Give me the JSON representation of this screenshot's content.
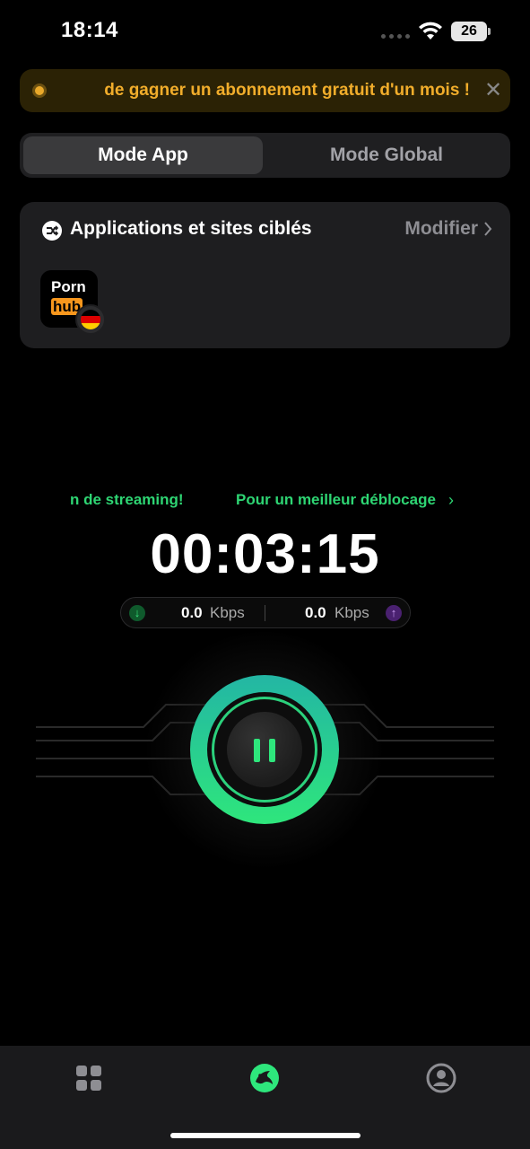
{
  "status_bar": {
    "time": "18:14",
    "battery": "26"
  },
  "promo": {
    "text": "de gagner un abonnement gratuit d'un mois !",
    "close_symbol": "✕",
    "accent_color": "#f1ad2b"
  },
  "mode_toggle": {
    "app_label": "Mode App",
    "global_label": "Mode Global",
    "selected": "Mode App"
  },
  "targets": {
    "title": "Applications et sites ciblés",
    "modify_label": "Modifier",
    "apps": [
      {
        "logo_top": "Porn",
        "logo_bottom": "hub",
        "country_flag": "germany-flag-icon"
      }
    ]
  },
  "ticker": {
    "text_1": "n de streaming!",
    "text_2": "Pour un meilleur déblocage",
    "color": "#2ed573"
  },
  "connection": {
    "elapsed": "00:03:15",
    "download_value": "0.0",
    "download_unit": "Kbps",
    "upload_value": "0.0",
    "upload_unit": "Kbps",
    "state_icon": "pause-icon",
    "accent_color": "#2ee67c"
  },
  "tab_bar": {
    "tabs": [
      "apps-grid-icon",
      "home-logo-icon",
      "account-icon"
    ],
    "active": "home-logo-icon"
  }
}
